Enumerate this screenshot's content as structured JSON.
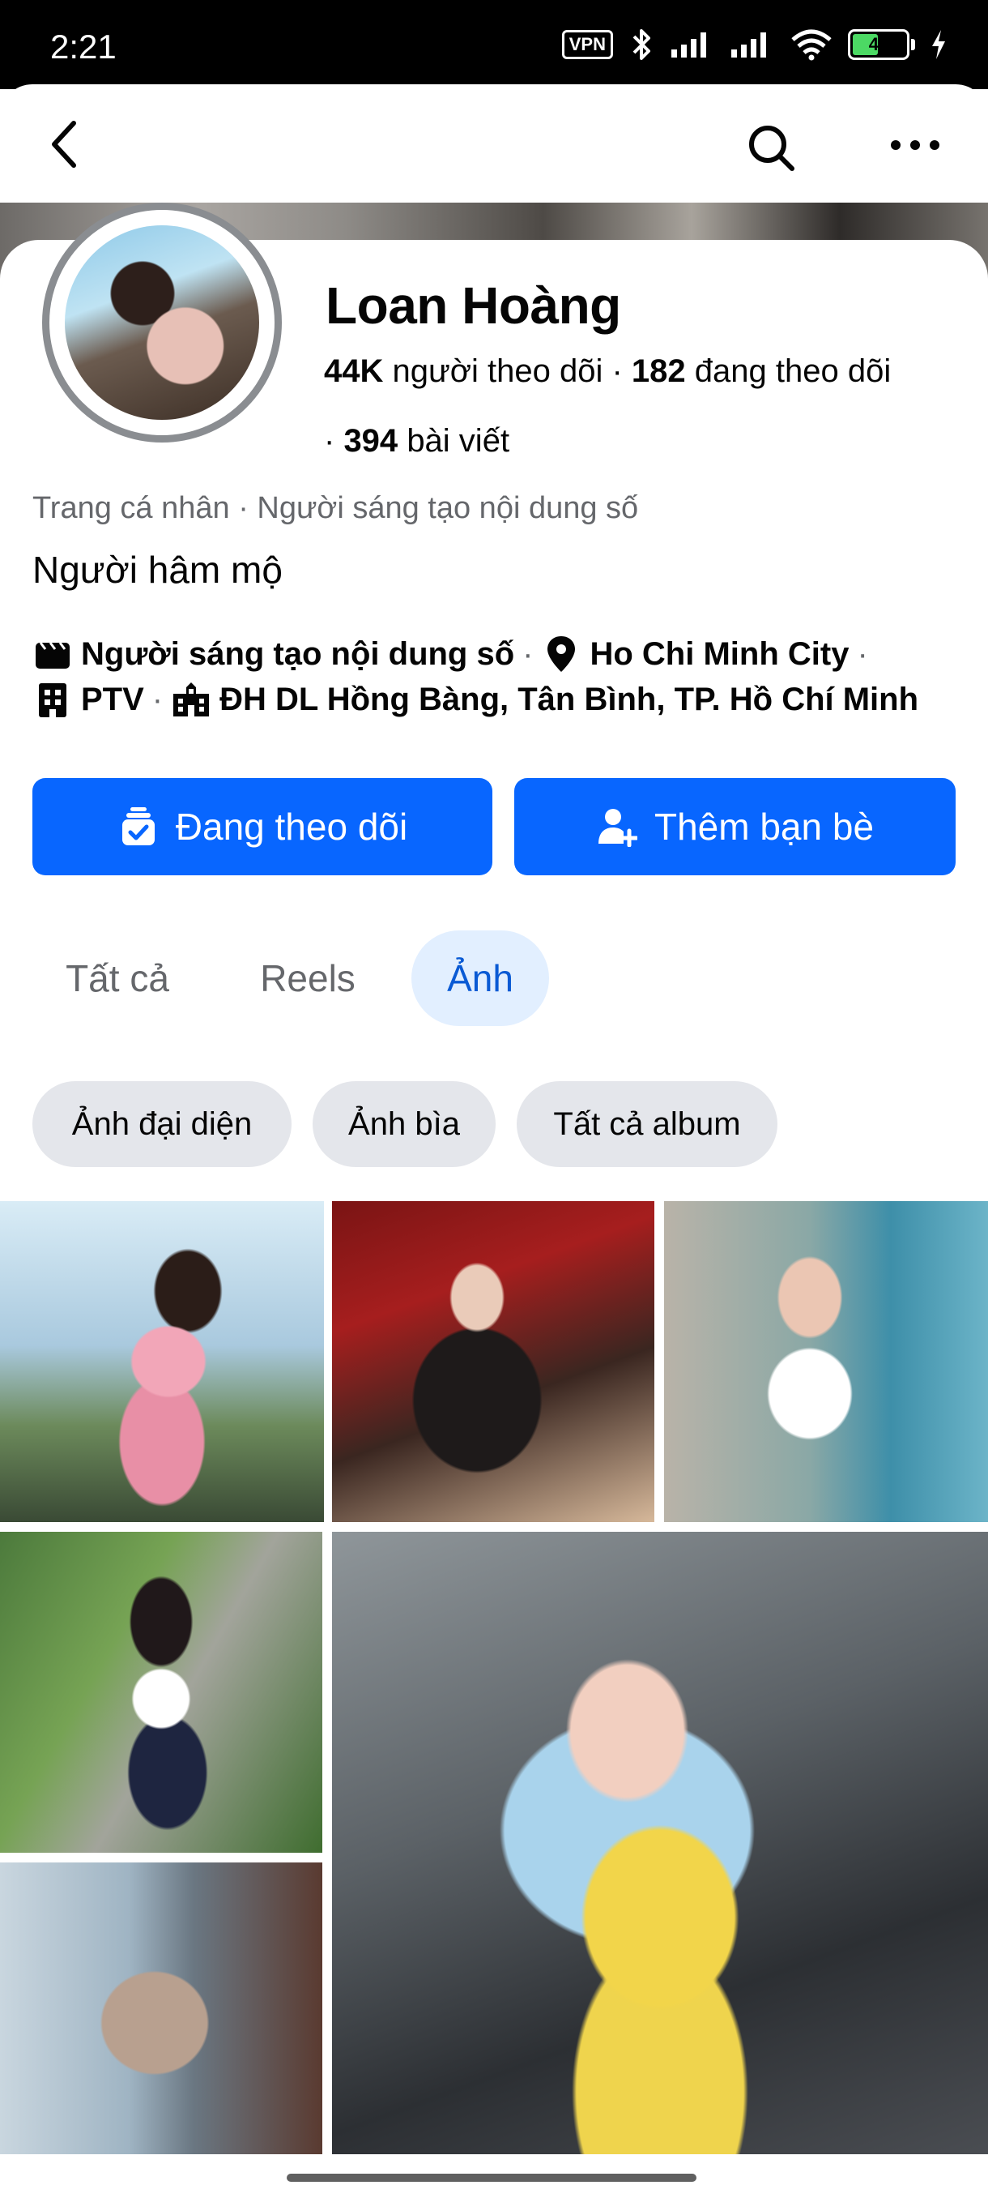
{
  "status_bar": {
    "time": "2:21",
    "vpn": "VPN",
    "battery": "49",
    "battery_level": 0.49
  },
  "header": {
    "back_icon": "back-arrow-icon",
    "search_icon": "search-icon",
    "more_icon": "more-icon"
  },
  "profile": {
    "name": "Loan Hoàng",
    "followers_count": "44K",
    "followers_label": "người theo dõi",
    "following_count": "182",
    "following_label": "đang theo dõi",
    "posts_count": "394",
    "posts_label": "bài viết",
    "subtitle": "Trang cá nhân · Người sáng tạo nội dung số",
    "bio": "Người hâm mộ",
    "details": {
      "category": "Người sáng tạo nội dung số",
      "location": "Ho Chi Minh City",
      "work": "PTV",
      "education": "ĐH DL Hồng Bàng, Tân Bình, TP. Hồ Chí Minh"
    }
  },
  "actions": {
    "following_button": "Đang theo dõi",
    "add_friend_button": "Thêm bạn bè"
  },
  "tabs": [
    {
      "label": "Tất cả"
    },
    {
      "label": "Reels"
    },
    {
      "label": "Ảnh",
      "active": true
    }
  ],
  "chips": [
    {
      "label": "Ảnh đại diện"
    },
    {
      "label": "Ảnh bìa"
    },
    {
      "label": "Tất cả album"
    }
  ],
  "colors": {
    "primary": "#0866ff",
    "tab_active_bg": "#e2efff",
    "tab_active_text": "#0a5ad4",
    "chip_bg": "#e4e6eb",
    "secondary_text": "#65676b"
  }
}
